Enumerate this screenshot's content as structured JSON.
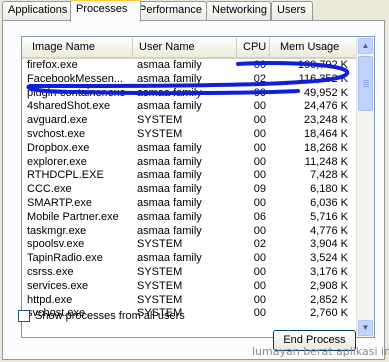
{
  "tabs": [
    {
      "label": "Applications",
      "active": false
    },
    {
      "label": "Processes",
      "active": true
    },
    {
      "label": "Performance",
      "active": false
    },
    {
      "label": "Networking",
      "active": false
    },
    {
      "label": "Users",
      "active": false
    }
  ],
  "columns": {
    "image_name": "Image Name",
    "user_name": "User Name",
    "cpu": "CPU",
    "mem_usage": "Mem Usage"
  },
  "processes": [
    {
      "image": "firefox.exe",
      "user": "asmaa family",
      "cpu": "00",
      "mem": "190,792 K"
    },
    {
      "image": "FacebookMessen...",
      "user": "asmaa family",
      "cpu": "02",
      "mem": "116,352 K"
    },
    {
      "image": "plugin-container.exe",
      "user": "asmaa family",
      "cpu": "00",
      "mem": "49,952 K"
    },
    {
      "image": "4sharedShot.exe",
      "user": "asmaa family",
      "cpu": "00",
      "mem": "24,476 K"
    },
    {
      "image": "avguard.exe",
      "user": "SYSTEM",
      "cpu": "00",
      "mem": "23,248 K"
    },
    {
      "image": "svchost.exe",
      "user": "SYSTEM",
      "cpu": "00",
      "mem": "18,464 K"
    },
    {
      "image": "Dropbox.exe",
      "user": "asmaa family",
      "cpu": "00",
      "mem": "18,268 K"
    },
    {
      "image": "explorer.exe",
      "user": "asmaa family",
      "cpu": "00",
      "mem": "11,248 K"
    },
    {
      "image": "RTHDCPL.EXE",
      "user": "asmaa family",
      "cpu": "00",
      "mem": "7,428 K"
    },
    {
      "image": "CCC.exe",
      "user": "asmaa family",
      "cpu": "09",
      "mem": "6,180 K"
    },
    {
      "image": "SMARTP.exe",
      "user": "asmaa family",
      "cpu": "00",
      "mem": "6,036 K"
    },
    {
      "image": "Mobile Partner.exe",
      "user": "asmaa family",
      "cpu": "06",
      "mem": "5,716 K"
    },
    {
      "image": "taskmgr.exe",
      "user": "asmaa family",
      "cpu": "00",
      "mem": "4,776 K"
    },
    {
      "image": "spoolsv.exe",
      "user": "SYSTEM",
      "cpu": "02",
      "mem": "3,904 K"
    },
    {
      "image": "TapinRadio.exe",
      "user": "asmaa family",
      "cpu": "00",
      "mem": "3,524 K"
    },
    {
      "image": "csrss.exe",
      "user": "SYSTEM",
      "cpu": "00",
      "mem": "3,176 K"
    },
    {
      "image": "services.exe",
      "user": "SYSTEM",
      "cpu": "00",
      "mem": "2,908 K"
    },
    {
      "image": "httpd.exe",
      "user": "SYSTEM",
      "cpu": "00",
      "mem": "2,852 K"
    },
    {
      "image": "svchost.exe",
      "user": "SYSTEM",
      "cpu": "00",
      "mem": "2,760 K"
    }
  ],
  "show_all_label": "Show processes from all users",
  "show_all_checked": false,
  "end_process_label": "End Process",
  "watermark": "lumayan berat aplikasi ini",
  "scroll_up_icon": "arrow-up-icon",
  "scroll_down_icon": "arrow-down-icon",
  "annotation_color": "#1020d8",
  "tab_highlight_color": "#ffc83c"
}
